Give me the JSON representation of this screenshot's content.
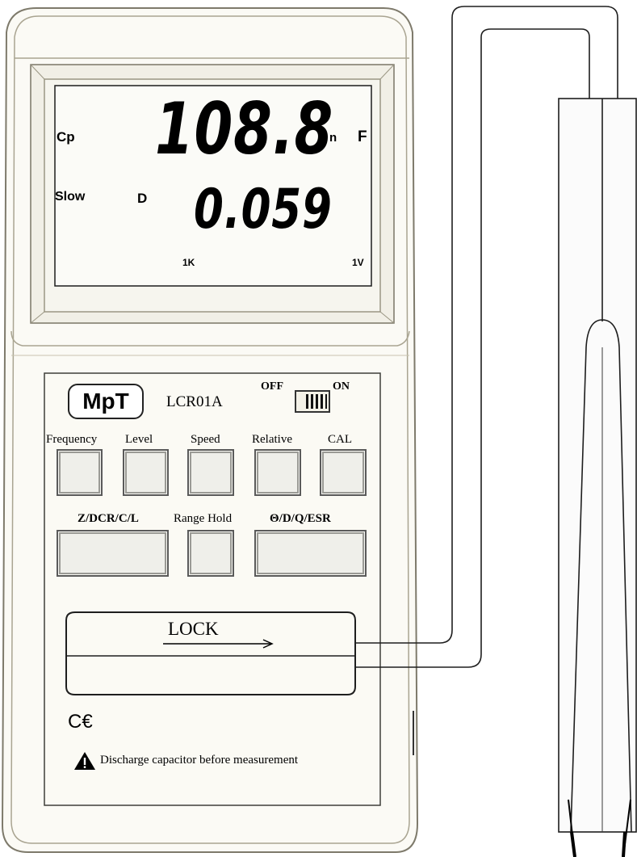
{
  "display": {
    "mode": "Cp",
    "primary_value": "108.8",
    "unit_prefix": "n",
    "unit": "F",
    "speed": "Slow",
    "secondary_label": "D",
    "secondary_value": "0.059",
    "frequency": "1K",
    "level": "1V"
  },
  "brand": {
    "logo": "MpT",
    "model": "LCR01A"
  },
  "power_switch": {
    "off_label": "OFF",
    "on_label": "ON",
    "state": "on"
  },
  "buttons_row1": [
    {
      "label": "Frequency"
    },
    {
      "label": "Level"
    },
    {
      "label": "Speed"
    },
    {
      "label": "Relative"
    },
    {
      "label": "CAL"
    }
  ],
  "buttons_row2": [
    {
      "label": "Z/DCR/C/L"
    },
    {
      "label": "Range Hold"
    },
    {
      "label": "Θ/D/Q/ESR"
    }
  ],
  "lock": {
    "label": "LOCK"
  },
  "marks": {
    "ce": "C€",
    "warning": "Discharge capacitor before measurement"
  },
  "icons": [
    "warning-triangle-icon",
    "arrow-right-icon"
  ]
}
